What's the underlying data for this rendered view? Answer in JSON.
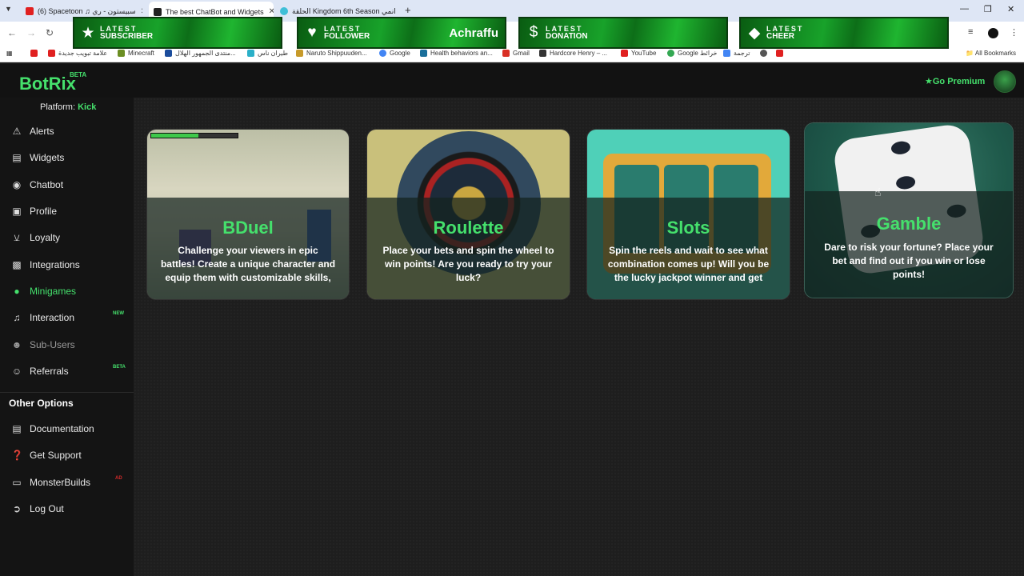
{
  "browser": {
    "tabs": [
      {
        "title": "(6) Spacetoon ♫ سبيستون - ري",
        "favicon_color": "#e02020"
      },
      {
        "title": "The best ChatBot and Widgets",
        "favicon_color": "#222222"
      },
      {
        "title": "الحلقة Kingdom 6th Season انمي",
        "favicon_color": "#3fbfd8"
      }
    ],
    "bookmarks": [
      {
        "label": "علامة تبويب جديدة",
        "color": "#e02020"
      },
      {
        "label": "Minecraft",
        "color": "#6b8e23"
      },
      {
        "label": "منتدى الجمهور الهلال...",
        "color": "#1b4c9c"
      },
      {
        "label": "طيران ناس",
        "color": "#2bb0c8"
      },
      {
        "label": "Naruto Shippuuden...",
        "color": "#c79a2a"
      },
      {
        "label": "Google",
        "color": "#4285f4"
      },
      {
        "label": "Health behaviors an...",
        "color": "#1a6f9a"
      },
      {
        "label": "Gmail",
        "color": "#d93025"
      },
      {
        "label": "Hardcore Henry – ...",
        "color": "#333333"
      },
      {
        "label": "YouTube",
        "color": "#e02020"
      },
      {
        "label": "Google خرائط",
        "color": "#34a853"
      },
      {
        "label": "ترجمة",
        "color": "#4285f4"
      }
    ],
    "all_bookmarks": "All Bookmarks"
  },
  "banners": [
    {
      "small": "LATEST",
      "big": "SUBSCRIBER",
      "icon": "star-icon",
      "name": ""
    },
    {
      "small": "LATEST",
      "big": "FOLLOWER",
      "icon": "heart-icon",
      "name": "Achraffu"
    },
    {
      "small": "LATEST",
      "big": "DONATION",
      "icon": "dollar-icon",
      "name": ""
    },
    {
      "small": "LATEST",
      "big": "CHEER",
      "icon": "diamond-icon",
      "name": ""
    }
  ],
  "header": {
    "logo": "BotRix",
    "logo_badge": "BETA",
    "premium": "Go Premium"
  },
  "sidebar": {
    "platform_label": "Platform:",
    "platform_value": "Kick",
    "items": [
      {
        "label": "Alerts",
        "icon": "warning-icon"
      },
      {
        "label": "Widgets",
        "icon": "widgets-icon"
      },
      {
        "label": "Chatbot",
        "icon": "robot-icon"
      },
      {
        "label": "Profile",
        "icon": "id-card-icon"
      },
      {
        "label": "Loyalty",
        "icon": "trophy-icon"
      },
      {
        "label": "Integrations",
        "icon": "integrations-icon"
      },
      {
        "label": "Minigames",
        "icon": "gamepad-icon"
      },
      {
        "label": "Interaction",
        "icon": "music-icon",
        "tag": "NEW"
      },
      {
        "label": "Sub-Users",
        "icon": "users-icon"
      },
      {
        "label": "Referrals",
        "icon": "user-friends-icon",
        "tag": "BETA"
      }
    ],
    "other_title": "Other Options",
    "other_items": [
      {
        "label": "Documentation",
        "icon": "book-icon"
      },
      {
        "label": "Get Support",
        "icon": "question-icon"
      },
      {
        "label": "MonsterBuilds",
        "icon": "laptop-icon",
        "tag": "AD"
      },
      {
        "label": "Log Out",
        "icon": "logout-icon"
      }
    ]
  },
  "games": [
    {
      "title": "BDuel",
      "desc": "Challenge your viewers in epic battles! Create a unique character and equip them with customizable skills, weapons,",
      "health_level": 0.55
    },
    {
      "title": "Roulette",
      "desc": "Place your bets and spin the wheel to win points! Are you ready to try your luck?"
    },
    {
      "title": "Slots",
      "desc": "Spin the reels and wait to see what combination comes up! Will you be the lucky jackpot winner and get bonus"
    },
    {
      "title": "Gamble",
      "desc": "Dare to risk your fortune? Place your bet and find out if you win or lose points!"
    }
  ],
  "colors": {
    "accent": "#45e06c",
    "tag_new": "#45e06c",
    "tag_beta": "#45e06c",
    "tag_ad": "#d62a2a"
  }
}
